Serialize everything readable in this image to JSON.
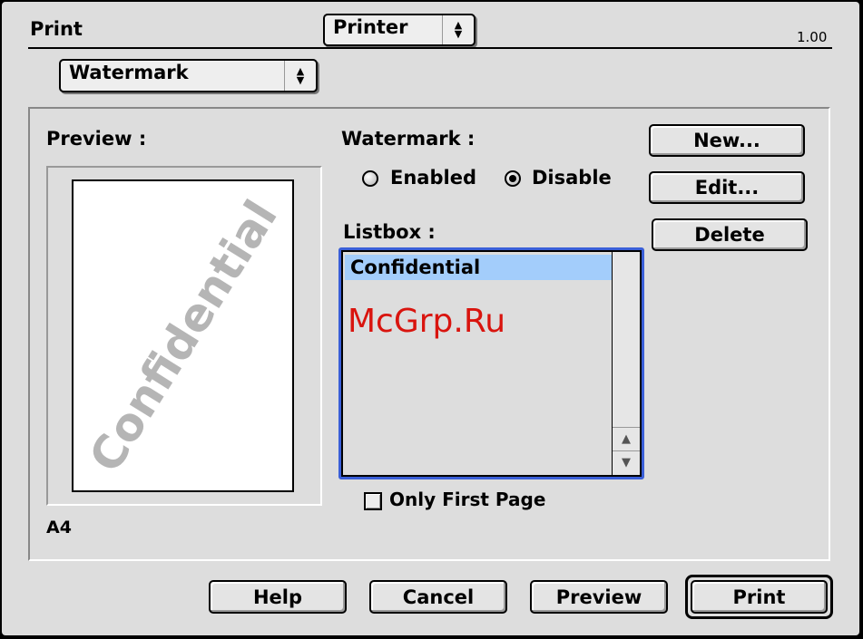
{
  "header": {
    "title": "Print",
    "version": "1.00",
    "printer_popup": "Printer",
    "panel_popup": "Watermark"
  },
  "preview": {
    "label": "Preview :",
    "watermark_text": "Confidential",
    "paper_size": "A4"
  },
  "watermark": {
    "label": "Watermark :",
    "enabled_label": "Enabled",
    "disable_label": "Disable",
    "selected": "Disable"
  },
  "listbox": {
    "label": "Listbox :",
    "items": [
      "Confidential"
    ],
    "selected_index": 0
  },
  "side_buttons": {
    "new": "New...",
    "edit": "Edit...",
    "delete": "Delete"
  },
  "only_first_page": {
    "label": "Only First Page",
    "checked": false
  },
  "overlay_text": "McGrp.Ru",
  "footer": {
    "help": "Help",
    "cancel": "Cancel",
    "preview": "Preview",
    "print": "Print"
  },
  "colors": {
    "window_bg": "#dddddd",
    "focus_ring": "#3a5fd8",
    "list_selection": "#a3cdfb",
    "overlay_text": "#d9140e"
  }
}
